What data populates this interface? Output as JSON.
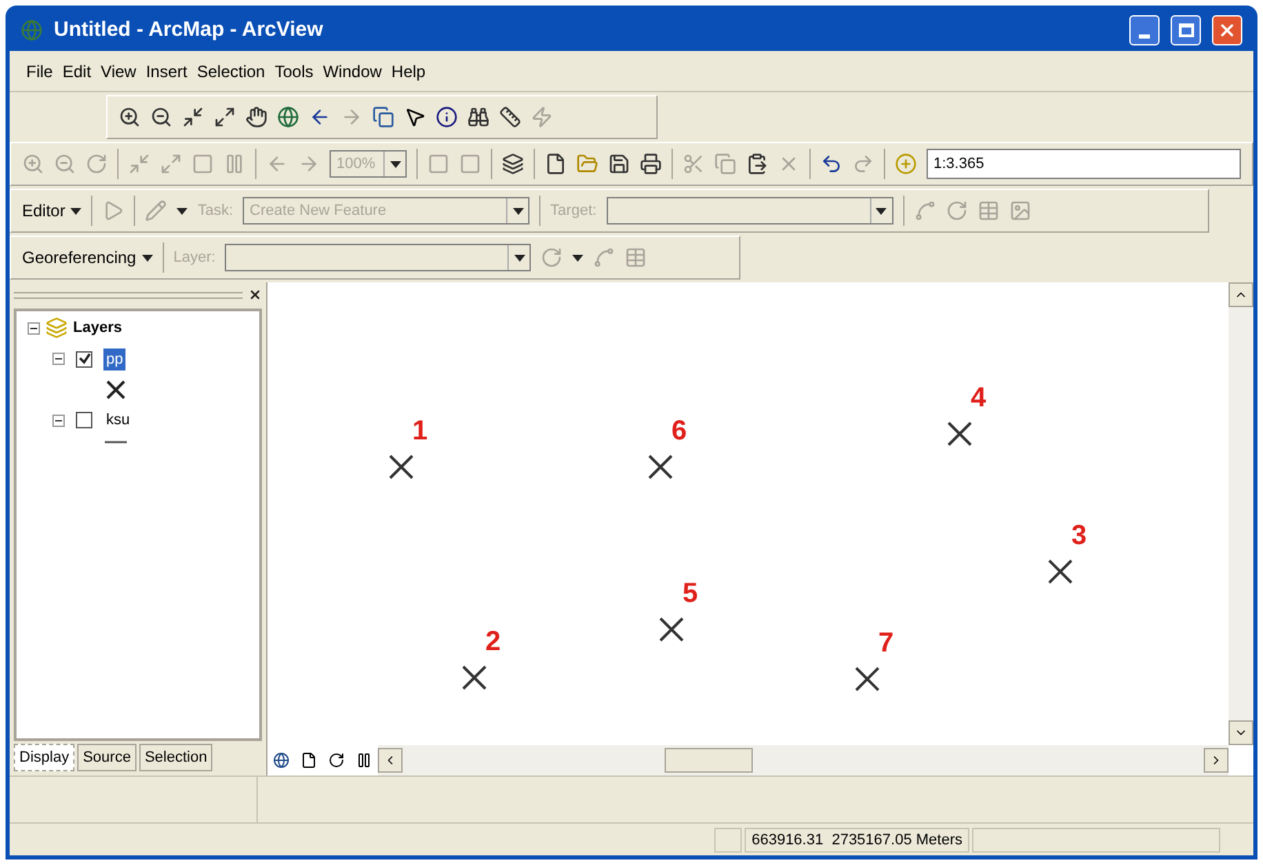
{
  "window": {
    "title": "Untitled - ArcMap - ArcView"
  },
  "menu": [
    "File",
    "Edit",
    "View",
    "Insert",
    "Selection",
    "Tools",
    "Window",
    "Help"
  ],
  "standard_toolbar": {
    "zoom": {
      "value": "100%",
      "disabled": true
    },
    "scale": {
      "value": "1:3.365"
    }
  },
  "editor_toolbar": {
    "menu": "Editor",
    "task_label": "Task:",
    "task": {
      "value": "Create New Feature",
      "disabled": true
    },
    "target_label": "Target:"
  },
  "georef_toolbar": {
    "menu": "Georeferencing",
    "layer_label": "Layer:"
  },
  "toc": {
    "root": {
      "label": "Layers",
      "expanded": true,
      "children": [
        {
          "label": "pp",
          "checked": true,
          "selected": true,
          "expanded": true,
          "kind": "point"
        },
        {
          "label": "ksu",
          "checked": false,
          "selected": false,
          "expanded": true,
          "kind": "line"
        }
      ]
    },
    "tabs": [
      {
        "label": "Display",
        "selected": true
      },
      {
        "label": "Source",
        "selected": false
      },
      {
        "label": "Selection",
        "selected": false
      }
    ]
  },
  "map": {
    "points": [
      {
        "label": "1"
      },
      {
        "label": "6"
      },
      {
        "label": "4"
      },
      {
        "label": "3"
      },
      {
        "label": "5"
      },
      {
        "label": "2"
      },
      {
        "label": "7"
      }
    ]
  },
  "status_bar": {
    "coordinates": "663916.31  2735167.05 Meters"
  }
}
